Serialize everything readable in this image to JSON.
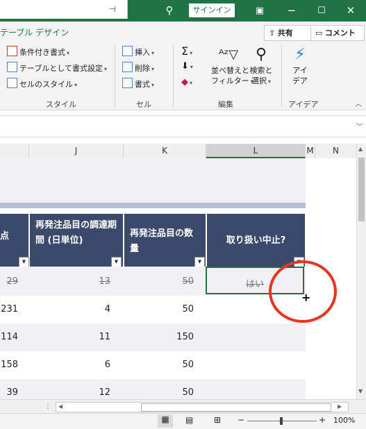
{
  "titlebar": {
    "signin": "サインイン"
  },
  "tabs": {
    "table_design": "テーブル デザイン",
    "share": "共有",
    "comment": "コメント"
  },
  "ribbon": {
    "styles": {
      "conditional": "条件付き書式",
      "format_table": "テーブルとして書式設定",
      "cell_styles": "セルのスタイル",
      "label": "スタイル"
    },
    "cells": {
      "insert": "挿入",
      "delete": "削除",
      "format": "書式",
      "label": "セル"
    },
    "editing": {
      "sort_l1": "並べ替えと",
      "sort_l2": "フィルター",
      "find_l1": "検索と",
      "find_l2": "選択",
      "label": "編集"
    },
    "ideas": {
      "l1": "アイ",
      "l2": "デア",
      "label": "アイデア"
    }
  },
  "columns": [
    "J",
    "K",
    "L",
    "M",
    "N"
  ],
  "table": {
    "headers": {
      "partial": "点",
      "j": "再発注品目の調達期間 (日単位)",
      "k": "再発注品目の数量",
      "l": "取り扱い中止?"
    },
    "rows": [
      {
        "a": "29",
        "j": "13",
        "k": "50",
        "l": "はい",
        "strike": true
      },
      {
        "a": "231",
        "j": "4",
        "k": "50",
        "l": "",
        "strike": false
      },
      {
        "a": "114",
        "j": "11",
        "k": "150",
        "l": "",
        "strike": false
      },
      {
        "a": "158",
        "j": "6",
        "k": "50",
        "l": "",
        "strike": false
      },
      {
        "a": "39",
        "j": "12",
        "k": "50",
        "l": "",
        "strike": false
      }
    ]
  },
  "status": {
    "zoom": "100%"
  },
  "colors": {
    "excel_green": "#217346",
    "header_navy": "#3b4a6b",
    "annotation_red": "#e8351f"
  }
}
